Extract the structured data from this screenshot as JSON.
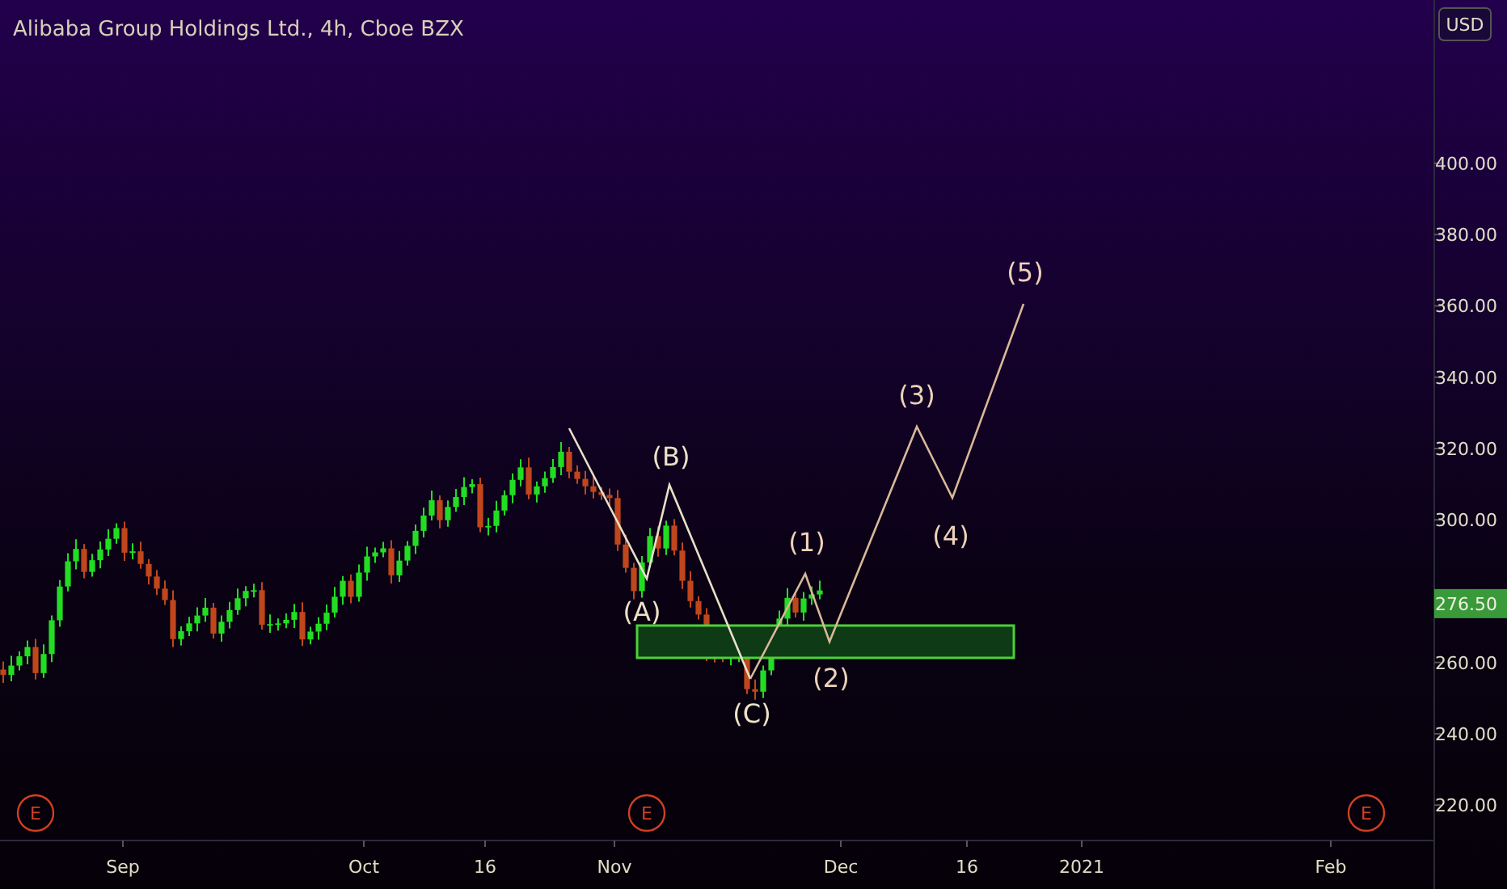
{
  "title": "Alibaba Group Holdings Ltd., 4h, Cboe BZX",
  "currency": "USD",
  "price_axis": [
    "400.00",
    "380.00",
    "360.00",
    "340.00",
    "320.00",
    "300.00",
    "260.00",
    "240.00",
    "220.00"
  ],
  "last_price": "276.50",
  "time_axis": [
    "Sep",
    "Oct",
    "16",
    "Nov",
    "Dec",
    "16",
    "2021",
    "Feb"
  ],
  "wave_labels": [
    {
      "text": "(B)",
      "kind": "corrective"
    },
    {
      "text": "(A)",
      "kind": "corrective"
    },
    {
      "text": "(C)",
      "kind": "corrective"
    },
    {
      "text": "(1)",
      "kind": "impulse"
    },
    {
      "text": "(2)",
      "kind": "impulse"
    },
    {
      "text": "(3)",
      "kind": "impulse"
    },
    {
      "text": "(4)",
      "kind": "impulse"
    },
    {
      "text": "(5)",
      "kind": "impulse"
    }
  ],
  "earnings_markers": [
    "E",
    "E",
    "E"
  ]
}
